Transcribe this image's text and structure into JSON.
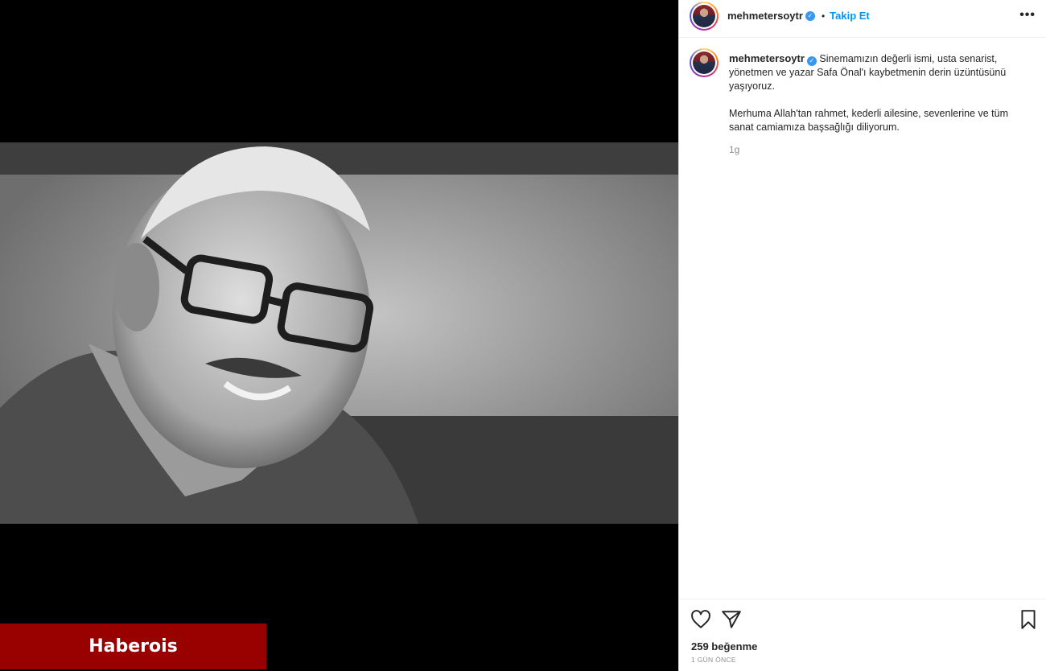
{
  "watermark": "Haberois",
  "post": {
    "username": "mehmetersoytr",
    "follow_label": "Takip Et",
    "separator": "•",
    "more_label": "•••",
    "caption_line1": "Sinemamızın değerli ismi, usta senarist, yönetmen ve yazar Safa Önal'ı kaybetmenin derin üzüntüsünü yaşıyoruz.",
    "caption_line2": "Merhuma Allah'tan rahmet, kederli ailesine, sevenlerine ve tüm sanat camiamıza başsağlığı diliyorum.",
    "relative_time": "1g",
    "likes": "259 beğenme",
    "posted_ago": "1 GÜN ÖNCE"
  },
  "icons": {
    "verified": "verified-badge-icon",
    "like": "heart-icon",
    "share": "paper-plane-icon",
    "save": "bookmark-icon"
  },
  "colors": {
    "accent": "#0095f6",
    "watermark_bg": "#990000",
    "verified": "#3897f0"
  }
}
